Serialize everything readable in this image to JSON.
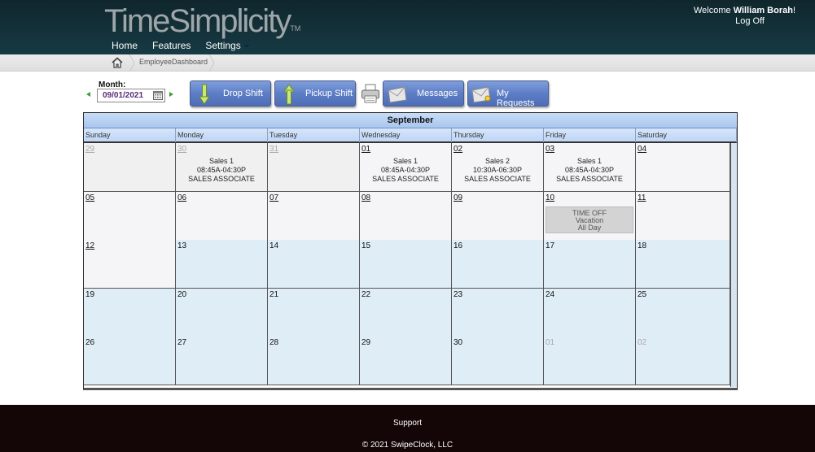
{
  "header": {
    "logo": "TimeSimplicity",
    "logo_tm": "TM",
    "nav": [
      "Home",
      "Features",
      "Settings"
    ],
    "welcome_prefix": "Welcome ",
    "user_name": "William Borah",
    "welcome_suffix": "!",
    "logoff": "Log Off"
  },
  "breadcrumb": {
    "current": "EmployeeDashboard"
  },
  "month_picker": {
    "label": "Month:",
    "value": "09/01/2021"
  },
  "toolbar": {
    "drop_shift": "Drop Shift",
    "pickup_shift": "Pickup Shift",
    "messages": "Messages",
    "my_requests": "My Requests"
  },
  "calendar": {
    "month_title": "September",
    "days_of_week": [
      "Sunday",
      "Monday",
      "Tuesday",
      "Wednesday",
      "Thursday",
      "Friday",
      "Saturday"
    ],
    "weeks": [
      [
        {
          "day": "29",
          "kind": "other"
        },
        {
          "day": "30",
          "kind": "other",
          "shift": [
            "Sales 1",
            "08:45A-04:30P",
            "SALES ASSOCIATE"
          ]
        },
        {
          "day": "31",
          "kind": "other"
        },
        {
          "day": "01",
          "kind": "cur",
          "shift": [
            "Sales 1",
            "08:45A-04:30P",
            "SALES ASSOCIATE"
          ]
        },
        {
          "day": "02",
          "kind": "cur",
          "shift": [
            "Sales 2",
            "10:30A-06:30P",
            "SALES ASSOCIATE"
          ]
        },
        {
          "day": "03",
          "kind": "cur",
          "shift": [
            "Sales 1",
            "08:45A-04:30P",
            "SALES ASSOCIATE"
          ]
        },
        {
          "day": "04",
          "kind": "cur"
        }
      ],
      [
        {
          "day": "05",
          "kind": "cur"
        },
        {
          "day": "06",
          "kind": "cur"
        },
        {
          "day": "07",
          "kind": "cur"
        },
        {
          "day": "08",
          "kind": "cur"
        },
        {
          "day": "09",
          "kind": "cur"
        },
        {
          "day": "10",
          "kind": "cur",
          "timeoff": [
            "TIME OFF",
            "Vacation",
            "All Day"
          ]
        },
        {
          "day": "11",
          "kind": "cur"
        }
      ],
      [
        {
          "day": "12",
          "kind": "cur"
        },
        {
          "day": "13",
          "kind": "future"
        },
        {
          "day": "14",
          "kind": "future"
        },
        {
          "day": "15",
          "kind": "future"
        },
        {
          "day": "16",
          "kind": "future"
        },
        {
          "day": "17",
          "kind": "future"
        },
        {
          "day": "18",
          "kind": "future"
        }
      ],
      [
        {
          "day": "19",
          "kind": "future"
        },
        {
          "day": "20",
          "kind": "future"
        },
        {
          "day": "21",
          "kind": "future"
        },
        {
          "day": "22",
          "kind": "future"
        },
        {
          "day": "23",
          "kind": "future"
        },
        {
          "day": "24",
          "kind": "future"
        },
        {
          "day": "25",
          "kind": "future"
        }
      ],
      [
        {
          "day": "26",
          "kind": "future"
        },
        {
          "day": "27",
          "kind": "future"
        },
        {
          "day": "28",
          "kind": "future"
        },
        {
          "day": "29",
          "kind": "future"
        },
        {
          "day": "30",
          "kind": "future"
        },
        {
          "day": "01",
          "kind": "future-other"
        },
        {
          "day": "02",
          "kind": "future-other"
        }
      ]
    ]
  },
  "footer": {
    "support": "Support",
    "copyright": "© 2021 SwipeClock, LLC"
  },
  "colors": {
    "header_bg": "#173a44",
    "button_blue": "#5d7ec6",
    "current_week_bg": "#f5f5f7",
    "future_bg": "#dfedf7",
    "footer_bg": "#140506"
  }
}
